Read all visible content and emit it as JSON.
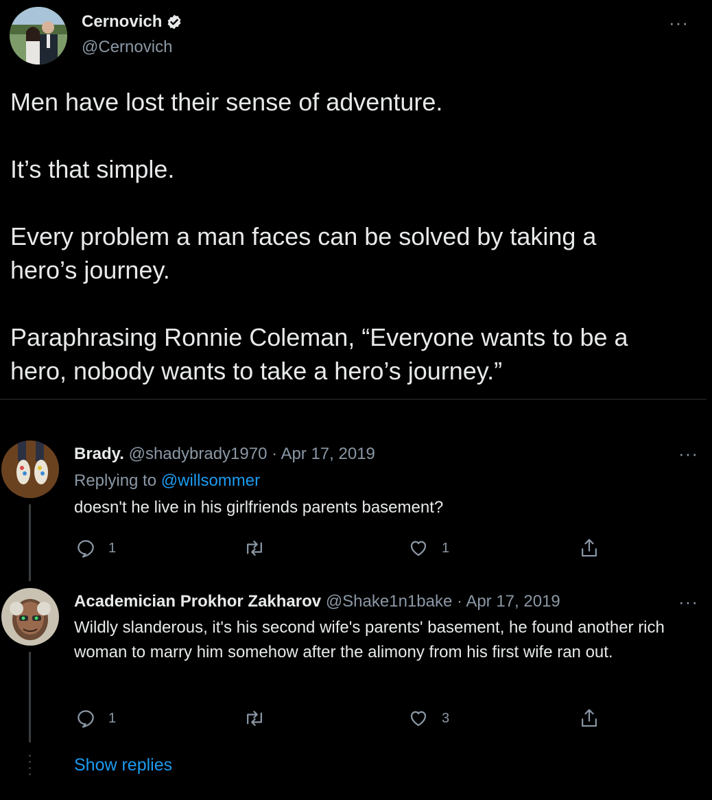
{
  "main_tweet": {
    "author_name": "Cernovich",
    "author_handle": "@Cernovich",
    "more_label": "···",
    "paragraphs": [
      "Men have lost their sense of adventure.",
      "It’s that simple.",
      "Every problem a man faces can be solved by taking a hero’s journey.",
      "Paraphrasing Ronnie Coleman, “Everyone wants to be a hero, nobody wants to take a hero’s journey.”"
    ]
  },
  "replies": [
    {
      "name": "Brady.",
      "handle": "@shadybrady1970",
      "date": "· Apr 17, 2019",
      "replying_prefix": "Replying to",
      "replying_to": "@willsommer",
      "text": "doesn't he live in his girlfriends parents basement?",
      "reply_count": "1",
      "retweet_count": "",
      "like_count": "1",
      "more_label": "···"
    },
    {
      "name": "Academician Prokhor Zakharov",
      "handle": "@Shake1n1bake",
      "date": "· Apr 17, 2019",
      "text": "Wildly slanderous, it's his second wife's parents' basement, he found another rich woman to marry him somehow after the alimony from his first wife ran out.",
      "reply_count": "1",
      "retweet_count": "",
      "like_count": "3",
      "more_label": "···"
    }
  ],
  "show_replies_label": "Show replies",
  "colors": {
    "background": "#000000",
    "text": "#e7e9ea",
    "muted": "#8b98a5",
    "link": "#1d9bf0"
  }
}
